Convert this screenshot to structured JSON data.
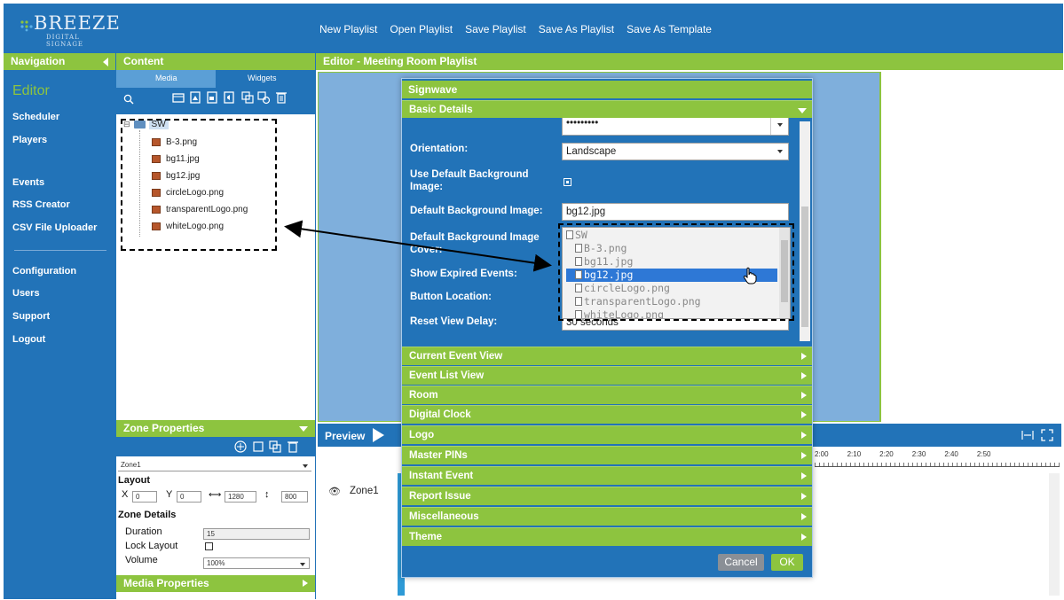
{
  "app": {
    "logo_text": "BREEZE",
    "logo_sub": "DIGITAL SIGNAGE",
    "menu": [
      "New Playlist",
      "Open Playlist",
      "Save Playlist",
      "Save As Playlist",
      "Save As Template"
    ]
  },
  "nav": {
    "header": "Navigation",
    "items": [
      "Editor",
      "Scheduler",
      "Players",
      "Events",
      "RSS Creator",
      "CSV File Uploader",
      "Configuration",
      "Users",
      "Support",
      "Logout"
    ]
  },
  "content": {
    "header": "Content",
    "tabs": [
      "Media",
      "Widgets"
    ],
    "folder": "SW",
    "files": [
      "B-3.png",
      "bg11.jpg",
      "bg12.jpg",
      "circleLogo.png",
      "transparentLogo.png",
      "whiteLogo.png"
    ]
  },
  "zone_properties": {
    "header": "Zone Properties",
    "zone_select": "Zone1",
    "layout_label": "Layout",
    "x_label": "X",
    "x_value": "0",
    "y_label": "Y",
    "y_value": "0",
    "width_value": "1280",
    "height_value": "800",
    "details_label": "Zone Details",
    "duration_label": "Duration",
    "duration_value": "15",
    "lock_label": "Lock Layout",
    "volume_label": "Volume",
    "volume_value": "100%",
    "media_properties": "Media Properties"
  },
  "editor": {
    "header": "Editor - Meeting Room Playlist",
    "preview_label": "Preview",
    "zone_row": "Zone1",
    "timeline_ticks": [
      "2:00",
      "2:10",
      "2:20",
      "2:30",
      "2:40",
      "2:50"
    ]
  },
  "dialog": {
    "title": "Signwave",
    "basic_details": "Basic Details",
    "password_value": "•••••••••",
    "orientation_label": "Orientation:",
    "orientation_value": "Landscape",
    "use_default_bg_label": "Use Default Background Image:",
    "default_bg_label": "Default Background Image:",
    "default_bg_value": "bg12.jpg",
    "default_bg_cover_label": "Default Background Image Cover:",
    "show_expired_label": "Show Expired Events:",
    "button_location_label": "Button Location:",
    "reset_view_label": "Reset View Delay:",
    "reset_view_value": "30 seconds",
    "dropdown_options": [
      "SW",
      "B-3.png",
      "bg11.jpg",
      "bg12.jpg",
      "circleLogo.png",
      "transparentLogo.png",
      "whiteLogo.png"
    ],
    "sections": [
      "Current Event View",
      "Event List View",
      "Room",
      "Digital Clock",
      "Logo",
      "Master PINs",
      "Instant Event",
      "Report Issue",
      "Miscellaneous",
      "Theme"
    ],
    "cancel_label": "Cancel",
    "ok_label": "OK"
  },
  "colors": {
    "brand_blue": "#2273b8",
    "accent_green": "#8dc43f",
    "selection_blue": "#2e78d6"
  }
}
